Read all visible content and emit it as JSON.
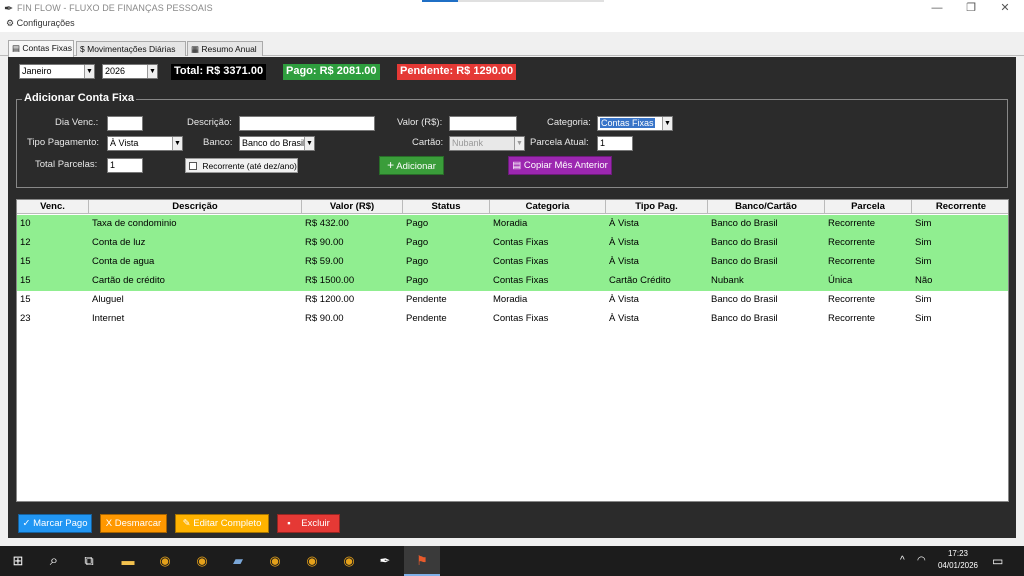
{
  "window": {
    "title": "FIN FLOW - FLUXO DE FINANÇAS PESSOAIS",
    "menu": "Configurações",
    "controls": [
      "—",
      "❐",
      "✕"
    ]
  },
  "tabs": [
    {
      "label": "Contas Fixas",
      "icon": "document-icon",
      "active": true
    },
    {
      "label": "Movimentações Diárias",
      "icon": "money-icon",
      "active": false
    },
    {
      "label": "Resumo Anual",
      "icon": "calendar-icon",
      "active": false
    }
  ],
  "filters": {
    "month": "Janeiro",
    "year": "2026"
  },
  "summary": {
    "total": "Total: R$ 3371.00",
    "pago": "Pago: R$ 2081.00",
    "pendente": "Pendente: R$ 1290.00"
  },
  "form": {
    "title": "Adicionar Conta Fixa",
    "dia_label": "Dia Venc.:",
    "dia_value": "",
    "descricao_label": "Descrição:",
    "descricao_value": "",
    "valor_label": "Valor (R$):",
    "valor_value": "",
    "categoria_label": "Categoria:",
    "categoria_value": "Contas Fixas",
    "tipo_label": "Tipo Pagamento:",
    "tipo_value": "À Vista",
    "banco_label": "Banco:",
    "banco_value": "Banco do Brasil",
    "cartao_label": "Cartão:",
    "cartao_value": "Nubank",
    "parcela_label": "Parcela Atual:",
    "parcela_value": "1",
    "total_parcelas_label": "Total Parcelas:",
    "total_parcelas_value": "1",
    "recorrente_label": "Recorrente (até dez/ano)",
    "adicionar_label": "Adicionar",
    "copiar_label": "Copiar Mês Anterior"
  },
  "table": {
    "columns": [
      "Venc.",
      "Descrição",
      "Valor (R$)",
      "Status",
      "Categoria",
      "Tipo Pag.",
      "Banco/Cartão",
      "Parcela",
      "Recorrente"
    ],
    "rows": [
      {
        "venc": "10",
        "descricao": "Taxa de condominio",
        "valor": "R$ 432.00",
        "status": "Pago",
        "categoria": "Moradia",
        "tipo": "À Vista",
        "banco": "Banco do Brasil",
        "parcela": "Recorrente",
        "recorrente": "Sim"
      },
      {
        "venc": "12",
        "descricao": "Conta de luz",
        "valor": "R$ 90.00",
        "status": "Pago",
        "categoria": "Contas Fixas",
        "tipo": "À Vista",
        "banco": "Banco do Brasil",
        "parcela": "Recorrente",
        "recorrente": "Sim"
      },
      {
        "venc": "15",
        "descricao": "Conta de agua",
        "valor": "R$ 59.00",
        "status": "Pago",
        "categoria": "Contas Fixas",
        "tipo": "À Vista",
        "banco": "Banco do Brasil",
        "parcela": "Recorrente",
        "recorrente": "Sim"
      },
      {
        "venc": "15",
        "descricao": "Cartão de crédito",
        "valor": "R$ 1500.00",
        "status": "Pago",
        "categoria": "Contas Fixas",
        "tipo": "Cartão Crédito",
        "banco": "Nubank",
        "parcela": "Única",
        "recorrente": "Não"
      },
      {
        "venc": "15",
        "descricao": "Aluguel",
        "valor": "R$ 1200.00",
        "status": "Pendente",
        "categoria": "Moradia",
        "tipo": "À Vista",
        "banco": "Banco do Brasil",
        "parcela": "Recorrente",
        "recorrente": "Sim"
      },
      {
        "venc": "23",
        "descricao": "Internet",
        "valor": "R$ 90.00",
        "status": "Pendente",
        "categoria": "Contas Fixas",
        "tipo": "À Vista",
        "banco": "Banco do Brasil",
        "parcela": "Recorrente",
        "recorrente": "Sim"
      }
    ]
  },
  "actions": {
    "marcar_pago": "✓ Marcar Pago",
    "desmarcar": "X Desmarcar",
    "editar": "Editar Completo",
    "excluir": "Excluir"
  },
  "colors": {
    "paid_row": "#90ee90",
    "pending_row": "#ffffff",
    "total_badge": "#000000",
    "pago_badge": "#2e9e3e",
    "pendente_badge": "#e53935",
    "adicionar_btn": "#3a9d3a",
    "copiar_btn": "#9c27b0",
    "marcar_btn": "#2196f3",
    "desmarcar_btn": "#ff9800",
    "editar_btn": "#ffb300",
    "excluir_btn": "#e53935",
    "main_bg": "#2b2b2b"
  },
  "taskbar": {
    "time": "17:23",
    "date": "04/01/2026"
  }
}
